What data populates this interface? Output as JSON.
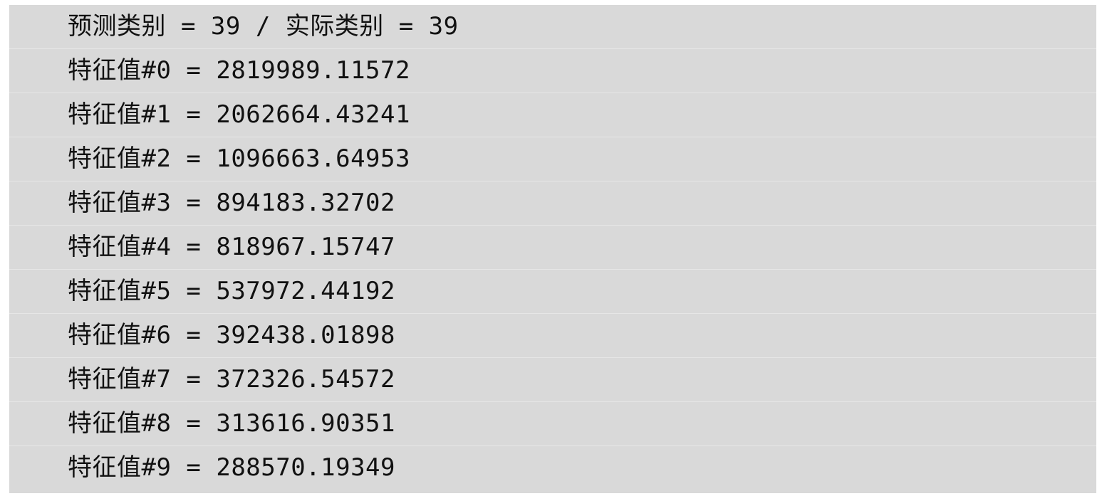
{
  "console": {
    "lines": [
      "预测类别 = 39 / 实际类别 = 39",
      "特征值#0 = 2819989.11572",
      "特征值#1 = 2062664.43241",
      "特征值#2 = 1096663.64953",
      "特征值#3 = 894183.32702",
      "特征值#4 = 818967.15747",
      "特征值#5 = 537972.44192",
      "特征值#6 = 392438.01898",
      "特征值#7 = 372326.54572",
      "特征值#8 = 313616.90351",
      "特征值#9 = 288570.19349"
    ]
  }
}
